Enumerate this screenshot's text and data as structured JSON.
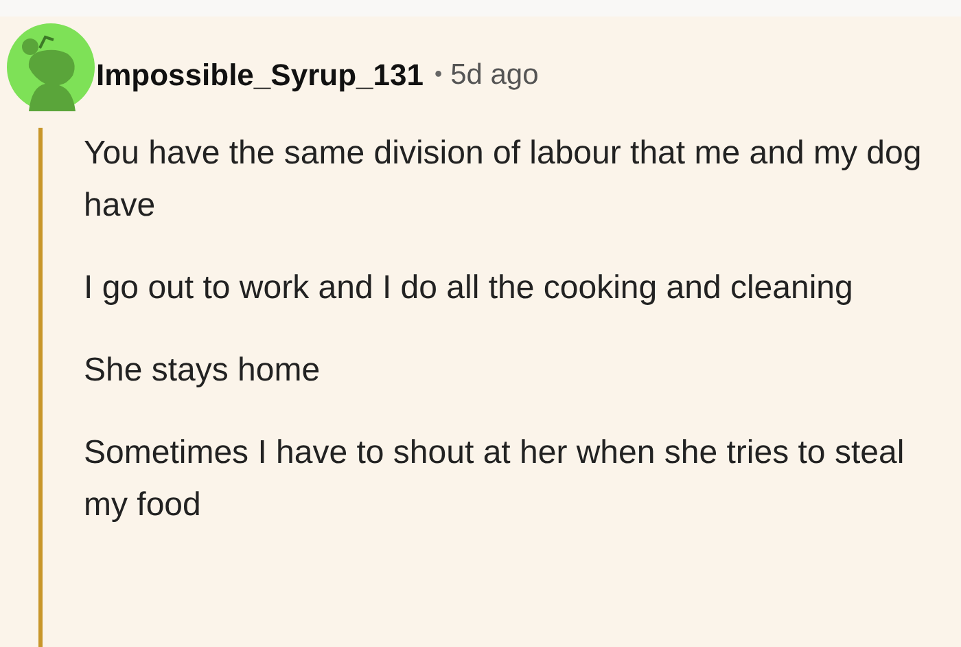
{
  "comment": {
    "author": "Impossible_Syrup_131",
    "separator": "•",
    "time": "5d ago",
    "paragraphs": [
      "You have the same division of labour that me and my dog have",
      "I go out to work and I do all the cooking and cleaning",
      "She stays home",
      "Sometimes I have to shout at her when she tries to steal my food"
    ]
  }
}
